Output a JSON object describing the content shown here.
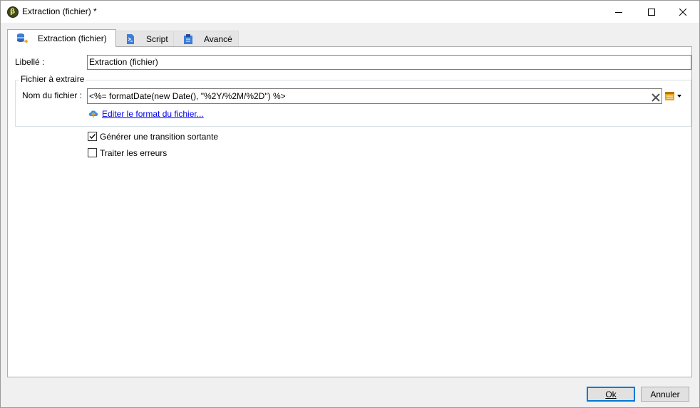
{
  "window": {
    "title": "Extraction (fichier) *",
    "app_icon_glyph": "β",
    "controls": [
      "minimize-icon",
      "maximize-icon",
      "close-icon"
    ]
  },
  "tabs": [
    {
      "label": "Extraction (fichier)",
      "icon": "database-export-icon",
      "active": true
    },
    {
      "label": "Script",
      "icon": "script-icon",
      "active": false
    },
    {
      "label": "Avancé",
      "icon": "clipboard-icon",
      "active": false
    }
  ],
  "form": {
    "libelle_label": "Libellé :",
    "libelle_value": "Extraction (fichier)",
    "group_title": "Fichier à extraire",
    "filename_label": "Nom du fichier :",
    "filename_value": "<%= formatDate(new Date(), \"%2Y/%2M/%2D\") %>",
    "edit_format_link": "Editer le format du fichier...",
    "checkboxes": [
      {
        "label": "Générer une transition sortante",
        "checked": true
      },
      {
        "label": "Traiter les erreurs",
        "checked": false
      }
    ]
  },
  "buttons": {
    "ok_label": "Ok",
    "cancel_label": "Annuler"
  },
  "colors": {
    "accent": "#0078d7",
    "link": "#0000ee",
    "title_bar": "#ffffff",
    "dialog_bg": "#f0f0f0"
  }
}
